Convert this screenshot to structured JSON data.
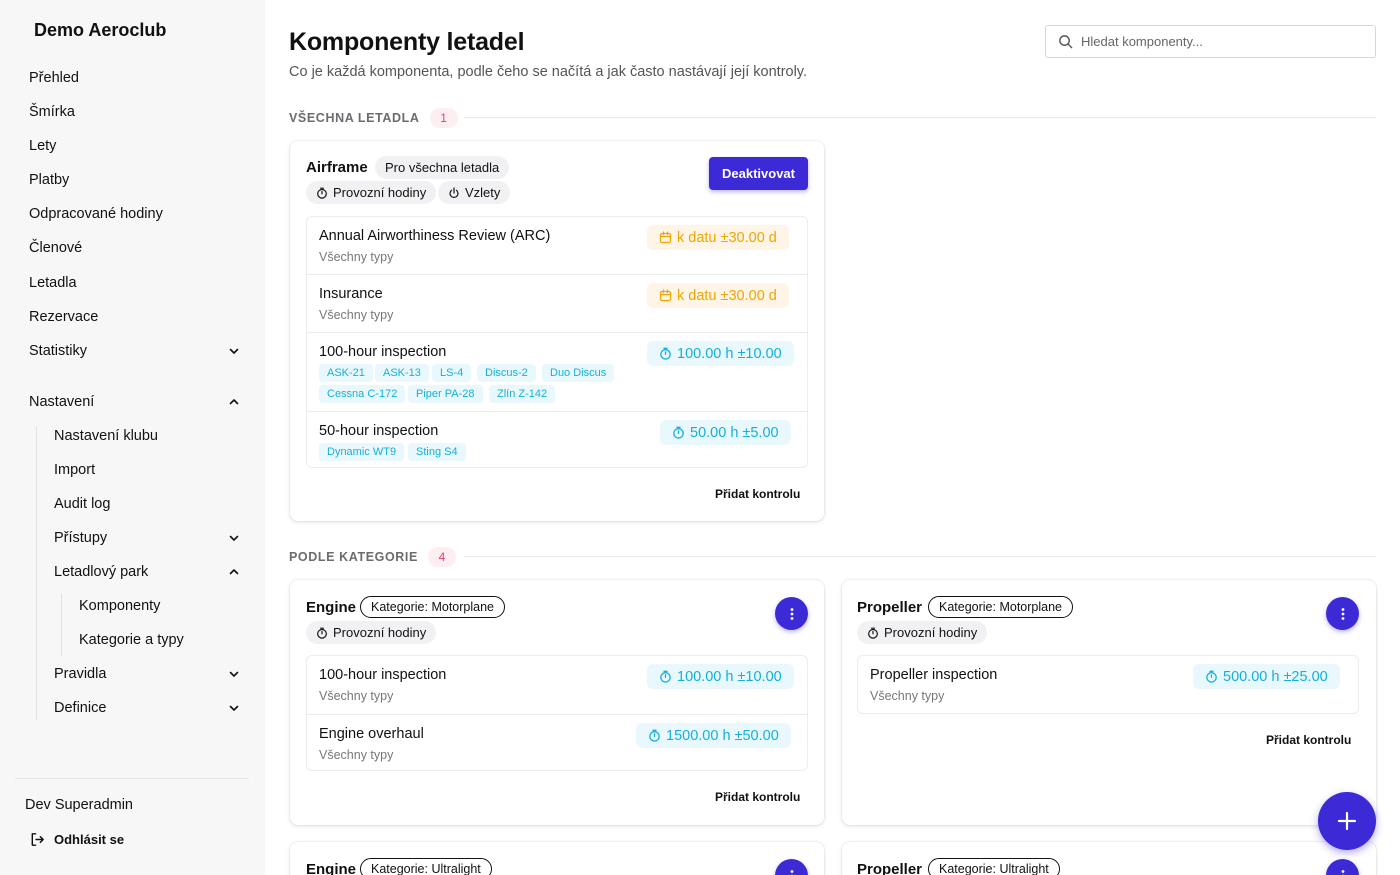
{
  "sidebar": {
    "brand": "Demo Aeroclub",
    "items": [
      {
        "label": "Přehled"
      },
      {
        "label": "Šmírka"
      },
      {
        "label": "Lety"
      },
      {
        "label": "Platby"
      },
      {
        "label": "Odpracované hodiny"
      },
      {
        "label": "Členové"
      },
      {
        "label": "Letadla"
      },
      {
        "label": "Rezervace"
      },
      {
        "label": "Statistiky",
        "chevron": "chevron-down-icon"
      },
      {
        "label": "Nastavení",
        "chevron": "chevron-up-icon"
      }
    ],
    "settings_children": [
      {
        "label": "Nastavení klubu"
      },
      {
        "label": "Import"
      },
      {
        "label": "Audit log"
      },
      {
        "label": "Přístupy",
        "chevron": "chevron-down-icon"
      },
      {
        "label": "Letadlový park",
        "chevron": "chevron-up-icon"
      },
      {
        "label": "Pravidla",
        "chevron": "chevron-down-icon"
      },
      {
        "label": "Definice",
        "chevron": "chevron-down-icon"
      }
    ],
    "fleet_children": [
      {
        "label": "Komponenty"
      },
      {
        "label": "Kategorie a typy"
      }
    ],
    "user_name": "Dev Superadmin",
    "logout_label": "Odhlásit se",
    "logout_icon": "logout-icon"
  },
  "header": {
    "title": "Komponenty letadel",
    "subtitle": "Co je každá komponenta, podle čeho se načítá a jak často nastávají její kontroly.",
    "search_placeholder": "Hledat komponenty..."
  },
  "colors": {
    "accent": "#3b2ad6",
    "date_pill_text": "#f0a500",
    "hours_pill_text": "#13b0dc",
    "count_badge": "#e0457b"
  },
  "sections": {
    "all": {
      "title": "VŠECHNA LETADLA",
      "count": "1"
    },
    "by_category": {
      "title": "PODLE KATEGORIE",
      "count": "4"
    }
  },
  "airframe": {
    "name": "Airframe",
    "scope": "Pro všechna letadla",
    "counters": [
      "Provozní hodiny",
      "Vzlety"
    ],
    "action": "Deaktivovat",
    "checks": [
      {
        "name": "Annual Airworthiness Review (ARC)",
        "sub": "Všechny typy",
        "interval": "k datu ±30.00 d",
        "kind": "date"
      },
      {
        "name": "Insurance",
        "sub": "Všechny typy",
        "interval": "k datu ±30.00 d",
        "kind": "date"
      },
      {
        "name": "100-hour inspection",
        "tags": [
          "ASK-21",
          "ASK-13",
          "LS-4",
          "Discus-2",
          "Duo Discus",
          "Cessna C-172",
          "Piper PA-28",
          "Zlín Z-142"
        ],
        "interval": "100.00 h ±10.00",
        "kind": "hours"
      },
      {
        "name": "50-hour inspection",
        "tags": [
          "Dynamic WT9",
          "Sting S4"
        ],
        "interval": "50.00 h ±5.00",
        "kind": "hours"
      }
    ],
    "add_check": "Přidat kontrolu"
  },
  "engine_motorplane": {
    "name": "Engine",
    "category": "Kategorie: Motorplane",
    "counter": "Provozní hodiny",
    "checks": [
      {
        "name": "100-hour inspection",
        "sub": "Všechny typy",
        "interval": "100.00 h ±10.00"
      },
      {
        "name": "Engine overhaul",
        "sub": "Všechny typy",
        "interval": "1500.00 h ±50.00"
      }
    ],
    "add_check": "Přidat kontrolu"
  },
  "propeller_motorplane": {
    "name": "Propeller",
    "category": "Kategorie: Motorplane",
    "counter": "Provozní hodiny",
    "checks": [
      {
        "name": "Propeller inspection",
        "sub": "Všechny typy",
        "interval": "500.00 h ±25.00"
      }
    ],
    "add_check": "Přidat kontrolu"
  },
  "engine_ultralight": {
    "name": "Engine",
    "category": "Kategorie: Ultralight"
  },
  "propeller_ultralight": {
    "name": "Propeller",
    "category": "Kategorie: Ultralight"
  }
}
